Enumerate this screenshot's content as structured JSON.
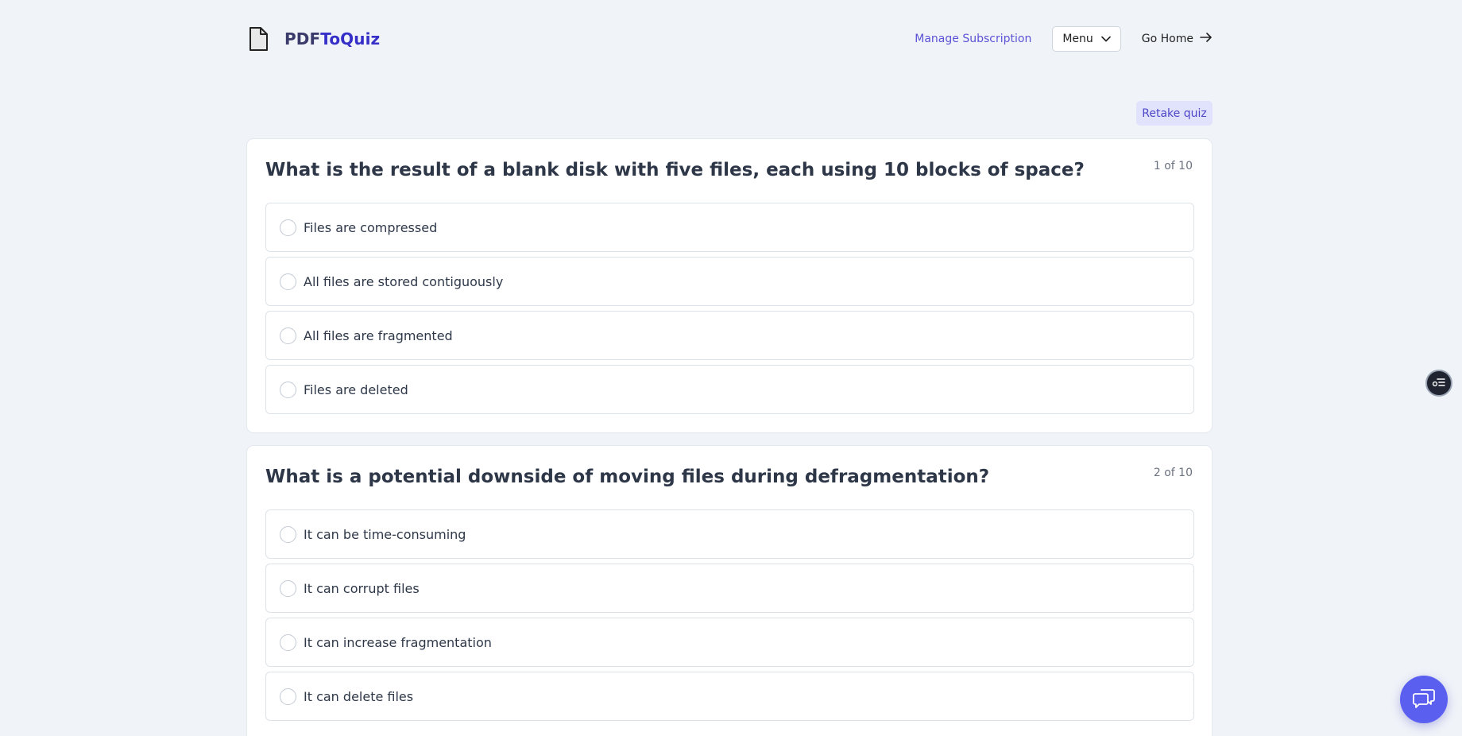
{
  "header": {
    "brand_part1": "PDF",
    "brand_part2": "ToQuiz",
    "manage_subscription": "Manage Subscription",
    "menu_label": "Menu",
    "go_home": "Go Home"
  },
  "actions": {
    "retake_label": "Retake quiz"
  },
  "questions": [
    {
      "title": "What is the result of a blank disk with five files, each using 10 blocks of space?",
      "count": "1 of 10",
      "options": [
        "Files are compressed",
        "All files are stored contiguously",
        "All files are fragmented",
        "Files are deleted"
      ]
    },
    {
      "title": "What is a potential downside of moving files during defragmentation?",
      "count": "2 of 10",
      "options": [
        "It can be time-consuming",
        "It can corrupt files",
        "It can increase fragmentation",
        "It can delete files"
      ]
    }
  ],
  "icons": {
    "brand": "document-icon",
    "menu": "chevron-down-icon",
    "home": "arrow-right-icon",
    "side": "settings-list-icon",
    "chat": "chat-bubbles-icon"
  },
  "colors": {
    "background": "#f0f3f8",
    "accent": "#5b52d6",
    "brand_accent": "#3730c8",
    "chat_button": "#5a5ff0"
  }
}
